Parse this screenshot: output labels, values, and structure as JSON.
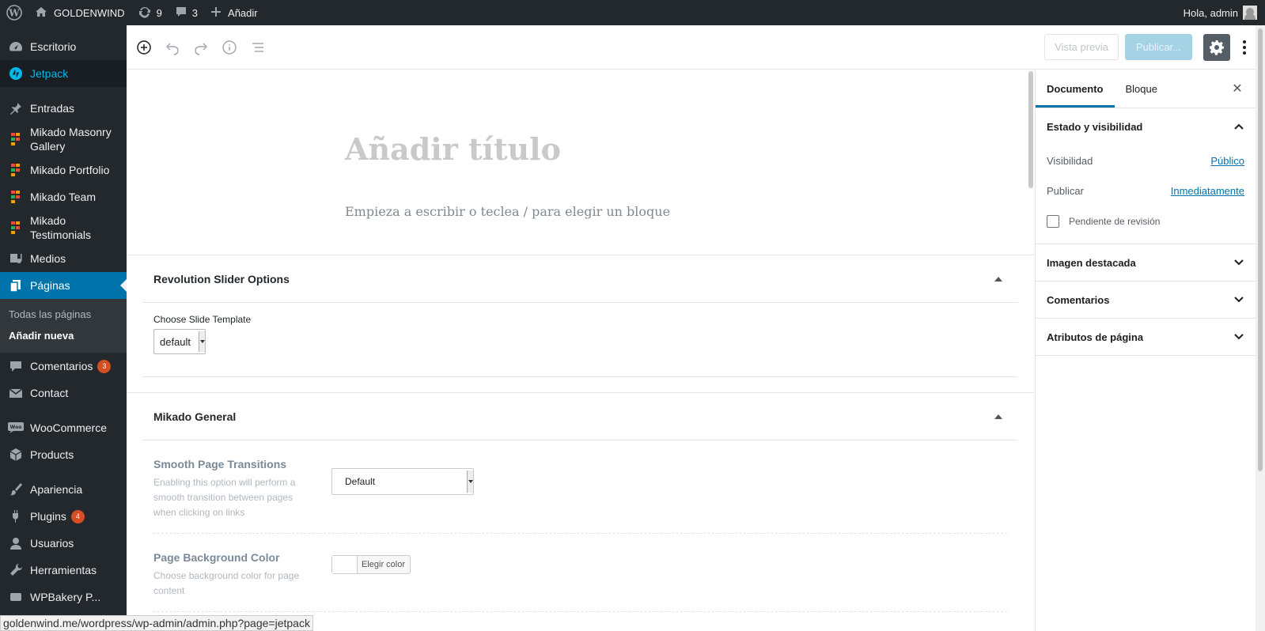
{
  "admin_bar": {
    "site_name": "GOLDENWIND",
    "updates_count": "9",
    "comments_count": "3",
    "add_new": "Añadir",
    "greeting": "Hola, admin"
  },
  "sidebar": {
    "items": [
      {
        "label": "Escritorio"
      },
      {
        "label": "Jetpack"
      },
      {
        "label": "Entradas"
      },
      {
        "label": "Mikado Masonry Gallery"
      },
      {
        "label": "Mikado Portfolio"
      },
      {
        "label": "Mikado Team"
      },
      {
        "label": "Mikado Testimonials"
      },
      {
        "label": "Medios"
      },
      {
        "label": "Páginas"
      },
      {
        "label": "Comentarios",
        "badge": "3"
      },
      {
        "label": "Contact"
      },
      {
        "label": "WooCommerce"
      },
      {
        "label": "Products"
      },
      {
        "label": "Apariencia"
      },
      {
        "label": "Plugins",
        "badge": "4"
      },
      {
        "label": "Usuarios"
      },
      {
        "label": "Herramientas"
      },
      {
        "label": "WPBakery P..."
      }
    ],
    "submenu": [
      "Todas las páginas",
      "Añadir nueva"
    ]
  },
  "toolbar": {
    "preview_label": "Vista previa",
    "publish_label": "Publicar..."
  },
  "editor": {
    "title_placeholder": "Añadir título",
    "body_placeholder": "Empieza a escribir o teclea / para elegir un bloque"
  },
  "revolution": {
    "heading": "Revolution Slider Options",
    "label": "Choose Slide Template",
    "value": "default"
  },
  "mikado": {
    "heading": "Mikado General",
    "options": [
      {
        "title": "Smooth Page Transitions",
        "desc": "Enabling this option will perform a smooth transition between pages when clicking on links",
        "value": "Default"
      },
      {
        "title": "Page Background Color",
        "desc": "Choose background color for page content",
        "button": "Elegir color"
      }
    ]
  },
  "settings_panel": {
    "tabs": [
      "Documento",
      "Bloque"
    ],
    "status_heading": "Estado y visibilidad",
    "visibility_label": "Visibilidad",
    "visibility_value": "Público",
    "publish_label": "Publicar",
    "publish_value": "Inmediatamente",
    "pending_label": "Pendiente de revisión",
    "sections": [
      "Imagen destacada",
      "Comentarios",
      "Atributos de página"
    ]
  },
  "status_url": "goldenwind.me/wordpress/wp-admin/admin.php?page=jetpack",
  "colors": {
    "admin_bg": "#23282d",
    "accent": "#0073aa",
    "jetpack": "#00b9eb",
    "badge": "#d54e21"
  }
}
